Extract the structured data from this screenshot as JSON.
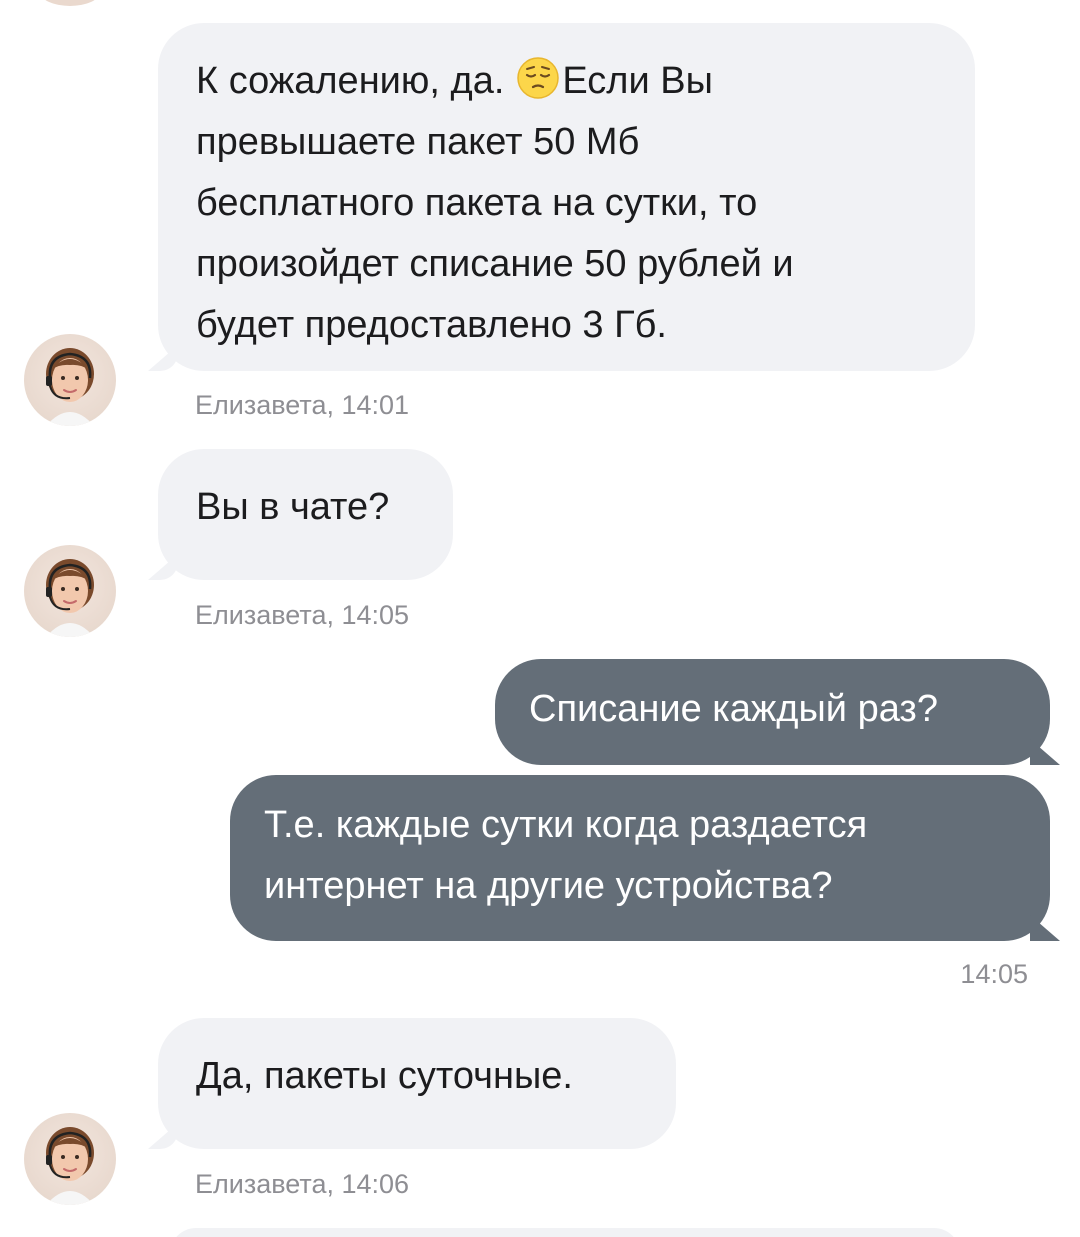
{
  "messages": [
    {
      "id": "m1",
      "lines": [
        "К сожалению, да.",
        "превышаете пакет 50 Мб",
        "бесплатного пакета на сутки, то",
        "произойдет списание 50 рублей и",
        "будет предоставлено 3 Гб."
      ],
      "line1_after_emoji": "Если Вы",
      "emoji": "pensive-face-icon",
      "meta": "Елизавета, 14:01"
    },
    {
      "id": "m2",
      "text": "Вы в чате?",
      "meta": "Елизавета, 14:05"
    },
    {
      "id": "m3",
      "text": "Списание каждый раз?"
    },
    {
      "id": "m4",
      "lines": [
        "Т.е. каждые сутки когда раздается",
        "интернет на другие устройства?"
      ],
      "meta": "14:05"
    },
    {
      "id": "m5",
      "text": "Да, пакеты суточные.",
      "meta": "Елизавета, 14:06"
    }
  ],
  "colors": {
    "incoming_bubble": "#f1f2f5",
    "outgoing_bubble": "#646e78",
    "meta_text": "#8e8e93"
  }
}
